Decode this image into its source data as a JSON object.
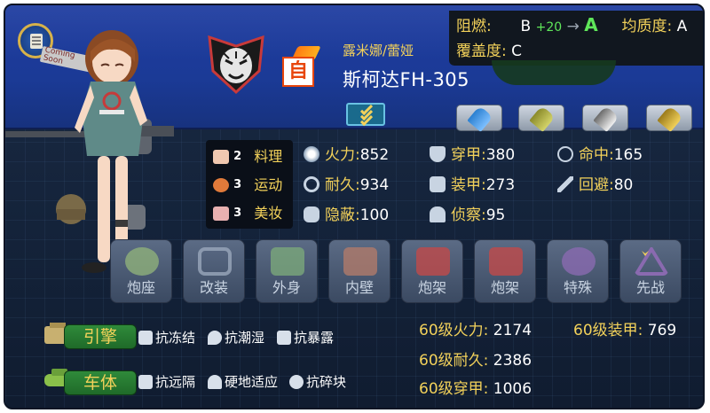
{
  "top_panel": {
    "flammability_label": "阻燃:",
    "flammability_from": "B",
    "flammability_bonus": "+20",
    "flammability_arrow": "→",
    "flammability_to": "A",
    "uniformity_label": "均质度:",
    "uniformity_value": "A",
    "coverage_label": "覆盖度:",
    "coverage_value": "C"
  },
  "header": {
    "coming_sign": "Coming Soon",
    "self_tag": "自",
    "crew_name": "露米娜/蕾娅",
    "vehicle_name": "斯柯达FH-305"
  },
  "ammo_slots": [
    "ammo-ap-icon",
    "ammo-he-icon",
    "ammo-silver-icon",
    "ammo-gold-icon"
  ],
  "skills": [
    {
      "level": "2",
      "name": "料理",
      "icon": "cooking-icon"
    },
    {
      "level": "3",
      "name": "运动",
      "icon": "basketball-icon"
    },
    {
      "level": "3",
      "name": "美妆",
      "icon": "makeup-icon"
    }
  ],
  "stats": {
    "firepower_label": "火力:",
    "firepower": "852",
    "penetration_label": "穿甲:",
    "penetration": "380",
    "accuracy_label": "命中:",
    "accuracy": "165",
    "durability_label": "耐久:",
    "durability": "934",
    "armor_label": "装甲:",
    "armor": "273",
    "evasion_label": "回避:",
    "evasion": "80",
    "stealth_label": "隐蔽:",
    "stealth": "100",
    "recon_label": "侦察:",
    "recon": "95"
  },
  "parts": [
    {
      "label": "炮座",
      "icon": "turret-seat-icon"
    },
    {
      "label": "改装",
      "icon": "hex-nut-icon"
    },
    {
      "label": "外身",
      "icon": "exterior-icon"
    },
    {
      "label": "内壁",
      "icon": "interior-wall-icon"
    },
    {
      "label": "炮架",
      "icon": "gun-mount-icon"
    },
    {
      "label": "炮架",
      "icon": "gun-mount-icon"
    },
    {
      "label": "特殊",
      "icon": "special-icon"
    },
    {
      "label": "先战",
      "icon": "first-strike-icon"
    }
  ],
  "engine": {
    "label": "引擎",
    "traits": [
      "抗冻结",
      "抗潮湿",
      "抗暴露"
    ]
  },
  "body": {
    "label": "车体",
    "traits": [
      "抗远隔",
      "硬地适应",
      "抗碎块"
    ]
  },
  "level60": {
    "firepower_label": "60级火力:",
    "firepower": "2174",
    "armor_label": "60级装甲:",
    "armor": "769",
    "durability_label": "60级耐久:",
    "durability": "2386",
    "penetration_label": "60级穿甲:",
    "penetration": "1006"
  },
  "colors": {
    "accent_gold": "#f2d15a",
    "accent_green": "#5fe65a",
    "header_blue": "#1e3ca0"
  }
}
